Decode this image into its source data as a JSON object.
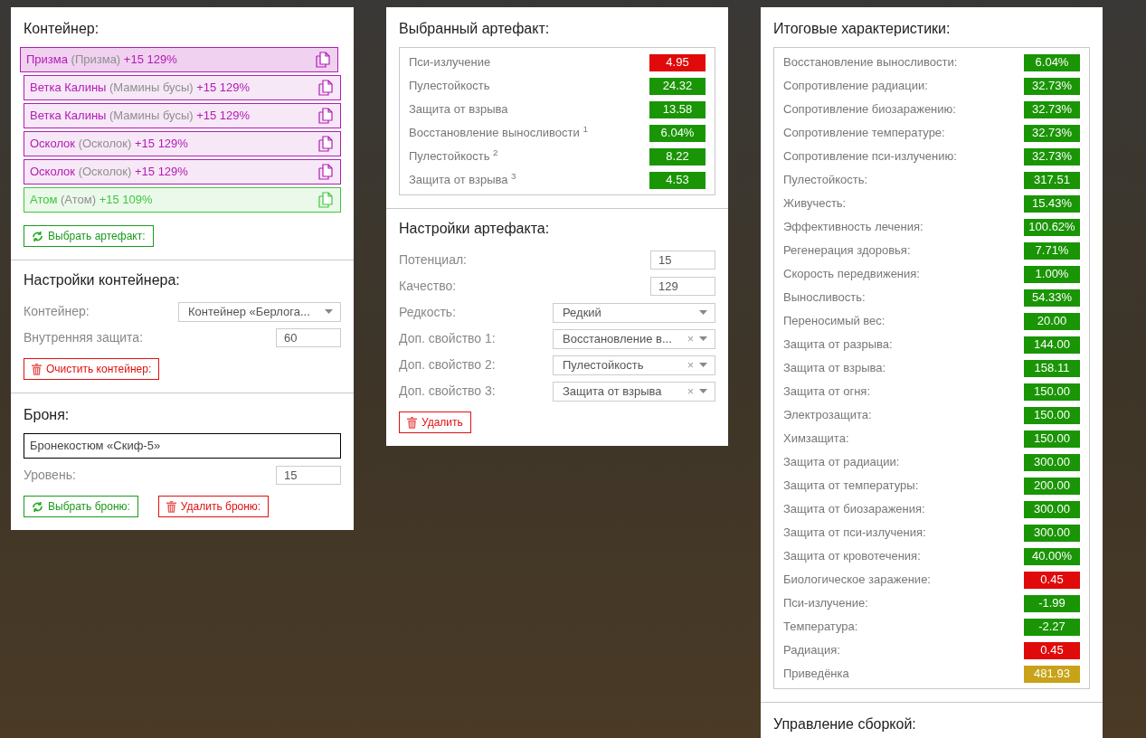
{
  "container": {
    "title": "Контейнер:",
    "artifacts": [
      {
        "name": "Призма",
        "alias": "(Призма)",
        "stats": "+15 129%",
        "color": "#b31bb5",
        "selected": true
      },
      {
        "name": "Ветка Калины",
        "alias": "(Мамины бусы)",
        "stats": "+15 129%",
        "color": "#b31bb5",
        "selected": false
      },
      {
        "name": "Ветка Калины",
        "alias": "(Мамины бусы)",
        "stats": "+15 129%",
        "color": "#b31bb5",
        "selected": false
      },
      {
        "name": "Осколок",
        "alias": "(Осколок)",
        "stats": "+15 129%",
        "color": "#b31bb5",
        "selected": false
      },
      {
        "name": "Осколок",
        "alias": "(Осколок)",
        "stats": "+15 129%",
        "color": "#b31bb5",
        "selected": false
      },
      {
        "name": "Атом",
        "alias": "(Атом)",
        "stats": "+15 109%",
        "color": "#3cc83c",
        "selected": false
      }
    ],
    "choose_button": "Выбрать артефакт:"
  },
  "container_settings": {
    "title": "Настройки контейнера:",
    "fields": [
      {
        "kind": "select",
        "label": "Контейнер:",
        "value": "Контейнер «Берлога..."
      },
      {
        "kind": "input",
        "label": "Внутренняя защита:",
        "value": "60"
      }
    ],
    "clear_button": "Очистить контейнер:"
  },
  "armor": {
    "title": "Броня:",
    "name": "Бронекостюм «Скиф-5»",
    "level_label": "Уровень:",
    "level_value": "15",
    "choose_button": "Выбрать броню:",
    "delete_button": "Удалить броню:"
  },
  "selected_artifact": {
    "title": "Выбранный артефакт:",
    "stats": [
      {
        "label": "Пси-излучение",
        "value": "4.95",
        "color": "#e00a0a"
      },
      {
        "label": "Пулестойкость",
        "value": "24.32",
        "color": "#1a9505"
      },
      {
        "label": "Защита от взрыва",
        "value": "13.58",
        "color": "#1a9505"
      },
      {
        "label": "Восстановление выносливости $^{1}$",
        "value": "6.04%",
        "color": "#1a9505"
      },
      {
        "label": "Пулестойкость $^{2}$",
        "value": "8.22",
        "color": "#1a9505"
      },
      {
        "label": "Защита от взрыва $^{3}$",
        "value": "4.53",
        "color": "#1a9505"
      }
    ]
  },
  "artifact_settings": {
    "title": "Настройки артефакта:",
    "fields": [
      {
        "kind": "input",
        "label": "Потенциал:",
        "value": "15"
      },
      {
        "kind": "input",
        "label": "Качество:",
        "value": "129"
      },
      {
        "kind": "select",
        "label": "Редкость:",
        "value": "Редкий"
      },
      {
        "kind": "select",
        "label": "Доп. свойство 1:",
        "value": "Восстановление в...",
        "clear_icon": "×"
      },
      {
        "kind": "select",
        "label": "Доп. свойство 2:",
        "value": "Пулестойкость",
        "clear_icon": "×"
      },
      {
        "kind": "select",
        "label": "Доп. свойство 3:",
        "value": "Защита от взрыва",
        "clear_icon": "×"
      }
    ],
    "delete_button": "Удалить"
  },
  "totals": {
    "title": "Итоговые характеристики:",
    "stats": [
      {
        "label": "Восстановление выносливости:",
        "value": "6.04%",
        "color": "#1a9505"
      },
      {
        "label": "Сопротивление радиации:",
        "value": "32.73%",
        "color": "#1a9505"
      },
      {
        "label": "Сопротивление биозаражению:",
        "value": "32.73%",
        "color": "#1a9505"
      },
      {
        "label": "Сопротивление температуре:",
        "value": "32.73%",
        "color": "#1a9505"
      },
      {
        "label": "Сопротивление пси-излучению:",
        "value": "32.73%",
        "color": "#1a9505"
      },
      {
        "label": "Пулестойкость:",
        "value": "317.51",
        "color": "#1a9505"
      },
      {
        "label": "Живучесть:",
        "value": "15.43%",
        "color": "#1a9505"
      },
      {
        "label": "Эффективность лечения:",
        "value": "100.62%",
        "color": "#1a9505"
      },
      {
        "label": "Регенерация здоровья:",
        "value": "7.71%",
        "color": "#1a9505"
      },
      {
        "label": "Скорость передвижения:",
        "value": "1.00%",
        "color": "#1a9505"
      },
      {
        "label": "Выносливость:",
        "value": "54.33%",
        "color": "#1a9505"
      },
      {
        "label": "Переносимый вес:",
        "value": "20.00",
        "color": "#1a9505"
      },
      {
        "label": "Защита от разрыва:",
        "value": "144.00",
        "color": "#1a9505"
      },
      {
        "label": "Защита от взрыва:",
        "value": "158.11",
        "color": "#1a9505"
      },
      {
        "label": "Защита от огня:",
        "value": "150.00",
        "color": "#1a9505"
      },
      {
        "label": "Электрозащита:",
        "value": "150.00",
        "color": "#1a9505"
      },
      {
        "label": "Химзащита:",
        "value": "150.00",
        "color": "#1a9505"
      },
      {
        "label": "Защита от радиации:",
        "value": "300.00",
        "color": "#1a9505"
      },
      {
        "label": "Защита от температуры:",
        "value": "200.00",
        "color": "#1a9505"
      },
      {
        "label": "Защита от биозаражения:",
        "value": "300.00",
        "color": "#1a9505"
      },
      {
        "label": "Защита от пси-излучения:",
        "value": "300.00",
        "color": "#1a9505"
      },
      {
        "label": "Защита от кровотечения:",
        "value": "40.00%",
        "color": "#1a9505"
      },
      {
        "label": "Биологическое заражение:",
        "value": "0.45",
        "color": "#e00a0a"
      },
      {
        "label": "Пси-излучение:",
        "value": "-1.99",
        "color": "#1a9505"
      },
      {
        "label": "Температура:",
        "value": "-2.27",
        "color": "#1a9505"
      },
      {
        "label": "Радиация:",
        "value": "0.45",
        "color": "#e00a0a"
      },
      {
        "label": "Приведёнка",
        "value": "481.93",
        "color": "#c8a218"
      }
    ]
  },
  "build_control": {
    "title": "Управление сборкой:"
  }
}
